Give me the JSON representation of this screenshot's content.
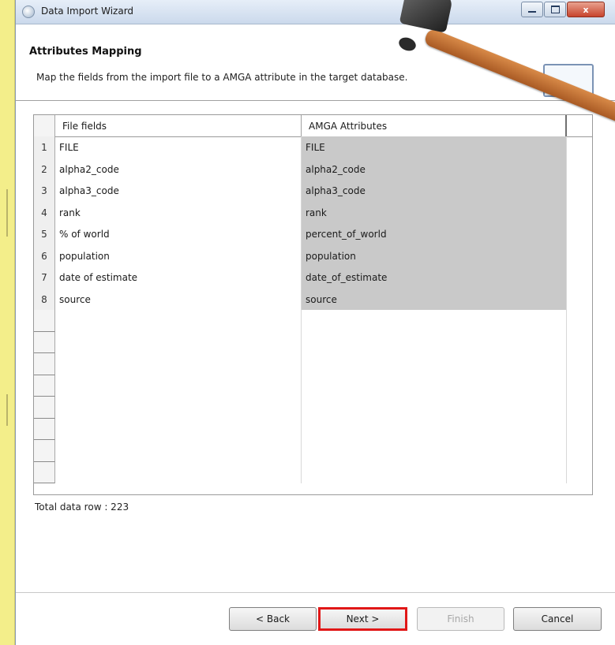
{
  "window": {
    "title": "Data Import Wizard",
    "controls": {
      "minimize": "minimize",
      "maximize": "maximize",
      "close": "x"
    }
  },
  "header": {
    "title": "Attributes Mapping",
    "description": "Map the fields from the import file to a AMGA attribute in the target database."
  },
  "table": {
    "columns": [
      "File fields",
      "AMGA Attributes"
    ],
    "rows": [
      {
        "index": "1",
        "file_field": "FILE",
        "amga_attribute": "FILE"
      },
      {
        "index": "2",
        "file_field": "alpha2_code",
        "amga_attribute": "alpha2_code"
      },
      {
        "index": "3",
        "file_field": "alpha3_code",
        "amga_attribute": "alpha3_code"
      },
      {
        "index": "4",
        "file_field": "rank",
        "amga_attribute": "rank"
      },
      {
        "index": "5",
        "file_field": "% of world",
        "amga_attribute": "percent_of_world"
      },
      {
        "index": "6",
        "file_field": "population",
        "amga_attribute": "population"
      },
      {
        "index": "7",
        "file_field": "date of estimate",
        "amga_attribute": "date_of_estimate"
      },
      {
        "index": "8",
        "file_field": "source",
        "amga_attribute": "source"
      }
    ]
  },
  "status": {
    "total_rows": "Total data row : 223"
  },
  "buttons": {
    "back": "< Back",
    "next": "Next >",
    "finish": "Finish",
    "cancel": "Cancel"
  },
  "colors": {
    "highlight": "#e11717",
    "amga_cell_bg": "#c9c9c9",
    "page_bg": "#fdfd98"
  }
}
